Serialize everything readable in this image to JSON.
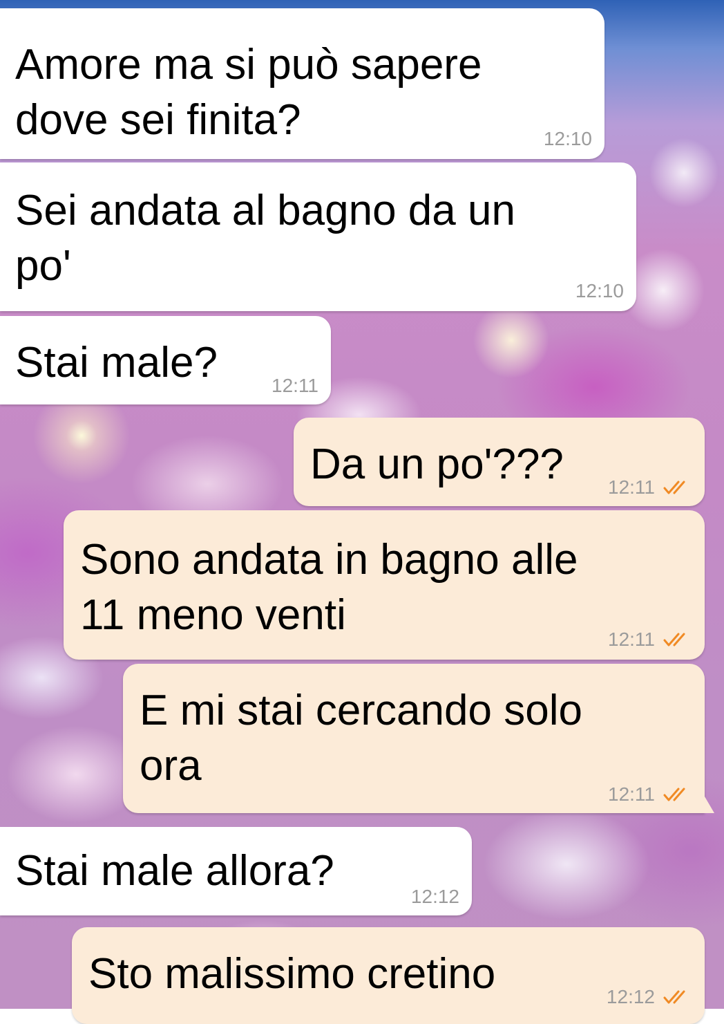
{
  "chat": {
    "messages": [
      {
        "direction": "incoming",
        "text": "Amore ma si può sapere\ndove sei finita?",
        "time": "12:10"
      },
      {
        "direction": "incoming",
        "text": "Sei andata al bagno da un\npo'",
        "time": "12:10"
      },
      {
        "direction": "incoming",
        "text": "Stai male?",
        "time": "12:11"
      },
      {
        "direction": "outgoing",
        "text": "Da un po'???",
        "time": "12:11",
        "status": "double-tick-read"
      },
      {
        "direction": "outgoing",
        "text": "Sono andata in bagno alle\n11 meno venti",
        "time": "12:11",
        "status": "double-tick-read"
      },
      {
        "direction": "outgoing",
        "text": "E mi stai cercando solo\nora",
        "time": "12:11",
        "status": "double-tick-read"
      },
      {
        "direction": "incoming",
        "text": "Stai male allora?",
        "time": "12:12"
      },
      {
        "direction": "outgoing",
        "text": "Sto malissimo cretino",
        "time": "12:12",
        "status": "double-tick-read"
      }
    ]
  },
  "colors": {
    "incoming_bubble": "#ffffff",
    "outgoing_bubble": "#fcebd8",
    "timestamp": "#9b9b9b",
    "read_ticks": "#f08a24"
  }
}
